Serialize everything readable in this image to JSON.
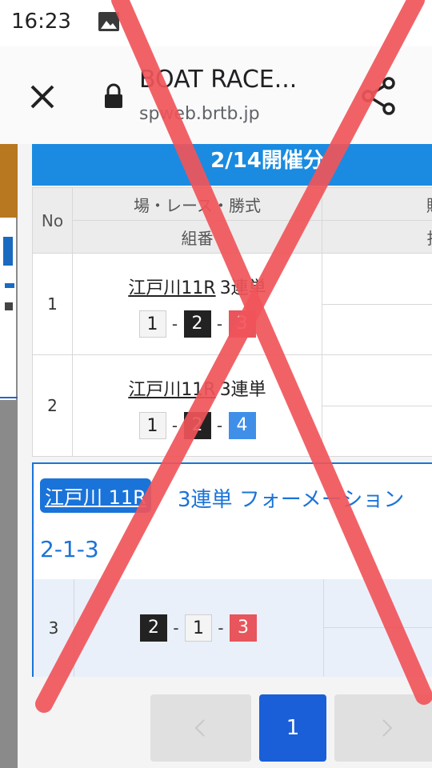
{
  "status_bar": {
    "time": "16:23"
  },
  "browser": {
    "title": "BOAT RACE...",
    "url": "spweb.brtb.jp"
  },
  "panel": {
    "header": "2/14開催分",
    "columns": {
      "no": "No",
      "venue_race_type": "場・レース・勝式",
      "combination": "組番",
      "purchase": "購入",
      "payout": "払戻"
    },
    "rows": [
      {
        "no": "1",
        "race": "江戸川11R",
        "bet_type": "3連単",
        "combo": [
          "1",
          "2",
          "3"
        ]
      },
      {
        "no": "2",
        "race": "江戸川11R",
        "bet_type": "3連単",
        "combo": [
          "1",
          "2",
          "4"
        ]
      }
    ],
    "formation": {
      "race_tag": "江戸川 11R",
      "bet_type": "3連単 フォーメーション",
      "combo_text": "2-1-3",
      "row": {
        "no": "3",
        "combo": [
          "2",
          "1",
          "3"
        ]
      }
    }
  },
  "pagination": {
    "current": "1"
  },
  "colors": {
    "header_blue": "#1a8be0",
    "link_blue": "#1a73d8",
    "boat1": "#f4f4f4",
    "boat2": "#222222",
    "boat3": "#e8555c",
    "boat4": "#3f8fe8",
    "overlay_red": "#f0555a"
  }
}
